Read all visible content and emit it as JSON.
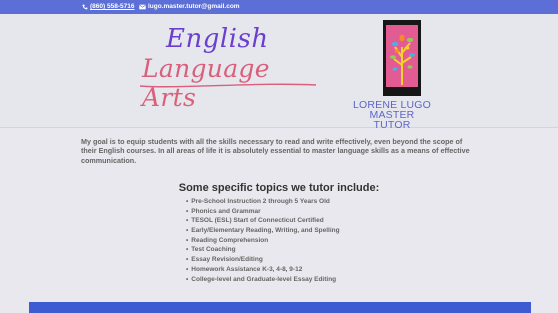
{
  "topbar": {
    "phone": "(860) 558-5716",
    "email": "lugo.master.tutor@gmail.com",
    "phone_icon": "phone-icon",
    "email_icon": "envelope-icon"
  },
  "logo": {
    "line1": "English",
    "line2": "Language Arts"
  },
  "tutor": {
    "name": "LORENE LUGO",
    "title": "MASTER TUTOR"
  },
  "intro": "My goal is to equip students with all the skills necessary to read and write effectively, even beyond the scope of their English courses. In all areas of life it is absolutely essential to master language skills as a means of effective communication.",
  "topics": {
    "heading": "Some specific topics we tutor include:",
    "items": [
      "Pre-School Instruction 2 through 5 Years Old",
      "Phonics and Grammar",
      "TESOL (ESL) Start of Connecticut Certified",
      "Early/Elementary Reading, Writing, and Spelling",
      "Reading Comprehension",
      "Test Coaching",
      "Essay Revision/Editing",
      "Homework Assistance K-3, 4-8, 9-12",
      "College-level and Graduate-level Essay Editing"
    ]
  },
  "colors": {
    "topbar": "#5b6fd6",
    "logo_purple": "#6a3fd0",
    "logo_pink": "#d9607a",
    "tutor_text": "#5f66c4",
    "footer": "#3f5bd2"
  }
}
